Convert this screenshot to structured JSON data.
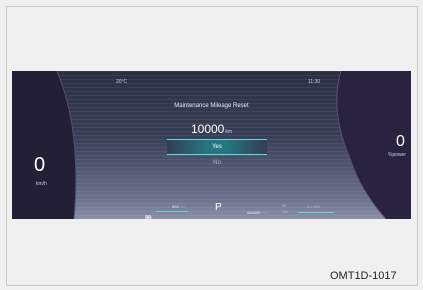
{
  "cluster": {
    "temperature": "20°C",
    "clock": "11:30",
    "title": "Maintenance Mileage Reset",
    "mileage_value": "10000",
    "mileage_unit": "km",
    "yes_label": "Yes",
    "no_label": "No",
    "speed_value": "0",
    "speed_unit": "km/h",
    "power_value": "0",
    "power_unit": "%power",
    "gear": "P",
    "range_value": "888",
    "range_unit": "km",
    "odo_value": "888888",
    "odo_unit": "km",
    "misc_value_top": "80",
    "misc_value_bottom": "100",
    "misc_right_value": "0.0",
    "misc_right_unit": "kWh"
  },
  "figure": {
    "caption": "OMT1D-1017"
  },
  "colors": {
    "accent": "#62d6d8",
    "screen_background": "#1a1d2a",
    "panel_purple": "#2c2540"
  },
  "icons": {
    "battery": "battery-icon",
    "fuel": "fuel-icon"
  }
}
